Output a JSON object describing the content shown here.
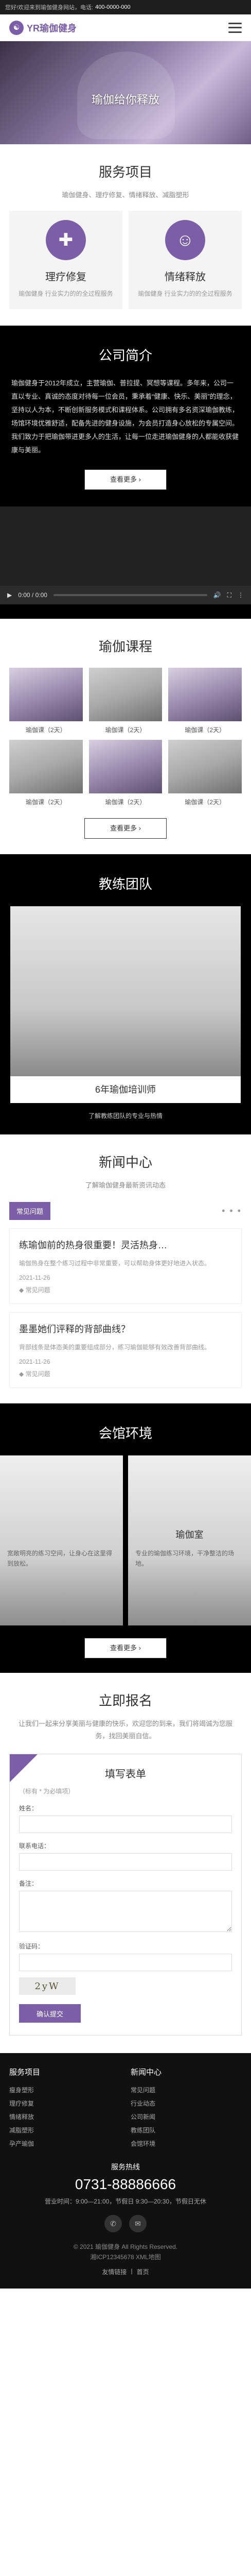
{
  "topbar": {
    "text": "您好!欢迎来到瑜伽健身网站，电话:",
    "phone": "400-0000-000"
  },
  "brand": {
    "name": "YR瑜伽健身",
    "mark": "☯"
  },
  "banner": {
    "text": "瑜伽给你释放"
  },
  "services": {
    "title": "服务项目",
    "subtitle": "瑜伽健身、理疗修复、情绪释放、减脂塑形",
    "items": [
      {
        "title": "理疗修复",
        "desc": "瑜伽健身 行业实力的的全过程服务"
      },
      {
        "title": "情绪释放",
        "desc": "瑜伽健身 行业实力的的全过程服务"
      }
    ]
  },
  "about": {
    "title": "公司简介",
    "text": "瑜伽健身于2012年成立，主营瑜伽、普拉提、冥想等课程。多年来，公司一直以专业、真诚的态度对待每一位会员，秉承着“健康、快乐、美丽”的理念，坚持以人为本，不断创新服务模式和课程体系。公司拥有多名资深瑜伽教练，场馆环境优雅舒适，配备先进的健身设施，为会员打造身心放松的专属空间。我们致力于把瑜伽带进更多人的生活，让每一位走进瑜伽健身的人都能收获健康与美丽。",
    "button": "查看更多 ›"
  },
  "video": {
    "time": "0:00 / 0:00"
  },
  "courses": {
    "title": "瑜伽课程",
    "items": [
      {
        "caption": "瑜伽课（2天）"
      },
      {
        "caption": "瑜伽课（2天）"
      },
      {
        "caption": "瑜伽课（2天）"
      },
      {
        "caption": "瑜伽课（2天）"
      },
      {
        "caption": "瑜伽课（2天）"
      },
      {
        "caption": "瑜伽课（2天）"
      }
    ],
    "button": "查看更多 ›"
  },
  "team": {
    "title": "教练团队",
    "caption": "6年瑜伽培训师",
    "subtitle": "了解教练团队的专业与热情"
  },
  "news": {
    "title": "新闻中心",
    "subtitle": "了解瑜伽健身最新资讯动态",
    "tab": "常见问题",
    "items": [
      {
        "title": "练瑜伽前的热身很重要！灵活热身…",
        "desc": "瑜伽热身在整个练习过程中非常重要，可以帮助身体更好地进入状态。",
        "date": "2021-11-26",
        "tag": "常见问题"
      },
      {
        "title": "墨墨她们评释的背部曲线？",
        "desc": "背部线条是体态美的重要组成部分，练习瑜伽能够有效改善背部曲线。",
        "date": "2021-11-26",
        "tag": "常见问题"
      }
    ]
  },
  "environment": {
    "title": "会馆环境",
    "items": [
      {
        "title": "",
        "desc": "宽敞明亮的练习空间，让身心在这里得到放松。"
      },
      {
        "title": "瑜伽室",
        "desc": "专业的瑜伽练习环境，干净整洁的场地。"
      }
    ],
    "button": "查看更多 ›"
  },
  "signup": {
    "title": "立即报名",
    "subtitle": "让我们一起来分享美丽与健康的快乐，欢迎您的到来，我们将竭诚为您服务，找回美丽自信。",
    "form_title": "填写表单",
    "hint": "（标有 * 为必填项）",
    "fields": [
      {
        "label": "姓名：",
        "placeholder": ""
      },
      {
        "label": "联系电话：",
        "placeholder": ""
      },
      {
        "label": "备注：",
        "placeholder": ""
      },
      {
        "label": "验证码：",
        "placeholder": ""
      }
    ],
    "captcha": "2yW",
    "submit": "确认提交"
  },
  "footer": {
    "col1": {
      "title": "服务项目",
      "items": [
        "瘦身塑形",
        "理疗修复",
        "情绪释放",
        "减脂塑形",
        "孕产瑜伽"
      ]
    },
    "col2": {
      "title": "新闻中心",
      "items": [
        "常见问题",
        "行业动态",
        "公司新闻",
        "教练团队",
        "会馆环境"
      ]
    },
    "hotline_label": "服务热线",
    "hotline": "0731-88886666",
    "hours": "营业时间：9:00—21:00，节假日 9:30—20:30，节假日无休",
    "copyright": "© 2021 瑜伽健身 All Rights Reserved.",
    "icp": "湘ICP12345678 XML地图",
    "bottom_nav": [
      "友情链接",
      "|",
      "首页"
    ]
  }
}
